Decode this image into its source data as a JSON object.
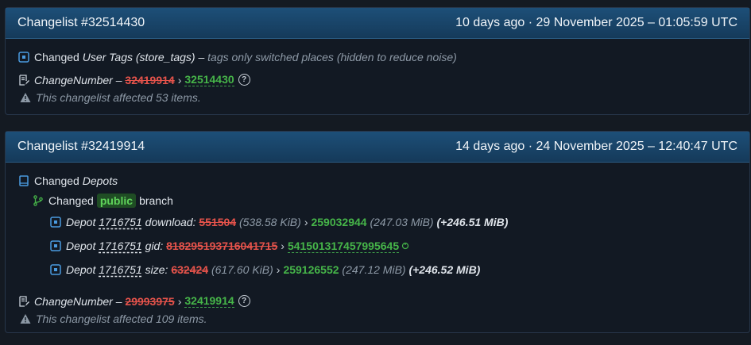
{
  "cards": [
    {
      "title": "Changelist #32514430",
      "time": "10 days ago · 29 November 2025 – 01:05:59 UTC",
      "rows": {
        "tags": {
          "prefix": "Changed",
          "name": "User Tags (store_tags)",
          "dash": "–",
          "note": "tags only switched places (hidden to reduce noise)"
        },
        "change": {
          "label": "ChangeNumber –",
          "old": "32419914",
          "arrow": "›",
          "new": "32514430",
          "help": "?"
        },
        "affected": "This changelist affected 53 items."
      }
    },
    {
      "title": "Changelist #32419914",
      "time": "14 days ago · 24 November 2025 – 12:40:47 UTC",
      "rows": {
        "depots": {
          "prefix": "Changed",
          "name": "Depots"
        },
        "branch": {
          "prefix": "Changed",
          "badge": "public",
          "suffix": "branch"
        },
        "download": {
          "label": "Depot",
          "depot": "1716751",
          "key": "download:",
          "old": "551504",
          "old_size": "(538.58 KiB)",
          "arrow": "›",
          "new": "259032944",
          "new_size": "(247.03 MiB)",
          "diff": "(+246.51 MiB)"
        },
        "gid": {
          "label": "Depot",
          "depot": "1716751",
          "key": "gid:",
          "old": "818295193716041715",
          "arrow": "›",
          "new": "541501317457995645"
        },
        "size": {
          "label": "Depot",
          "depot": "1716751",
          "key": "size:",
          "old": "632424",
          "old_size": "(617.60 KiB)",
          "arrow": "›",
          "new": "259126552",
          "new_size": "(247.12 MiB)",
          "diff": "(+246.52 MiB)"
        },
        "change": {
          "label": "ChangeNumber –",
          "old": "29993975",
          "arrow": "›",
          "new": "32419914",
          "help": "?"
        },
        "affected": "This changelist affected 109 items."
      }
    }
  ],
  "colors": {
    "removed": "#e5534b",
    "added": "#46b549",
    "header": "#1d4f78"
  }
}
